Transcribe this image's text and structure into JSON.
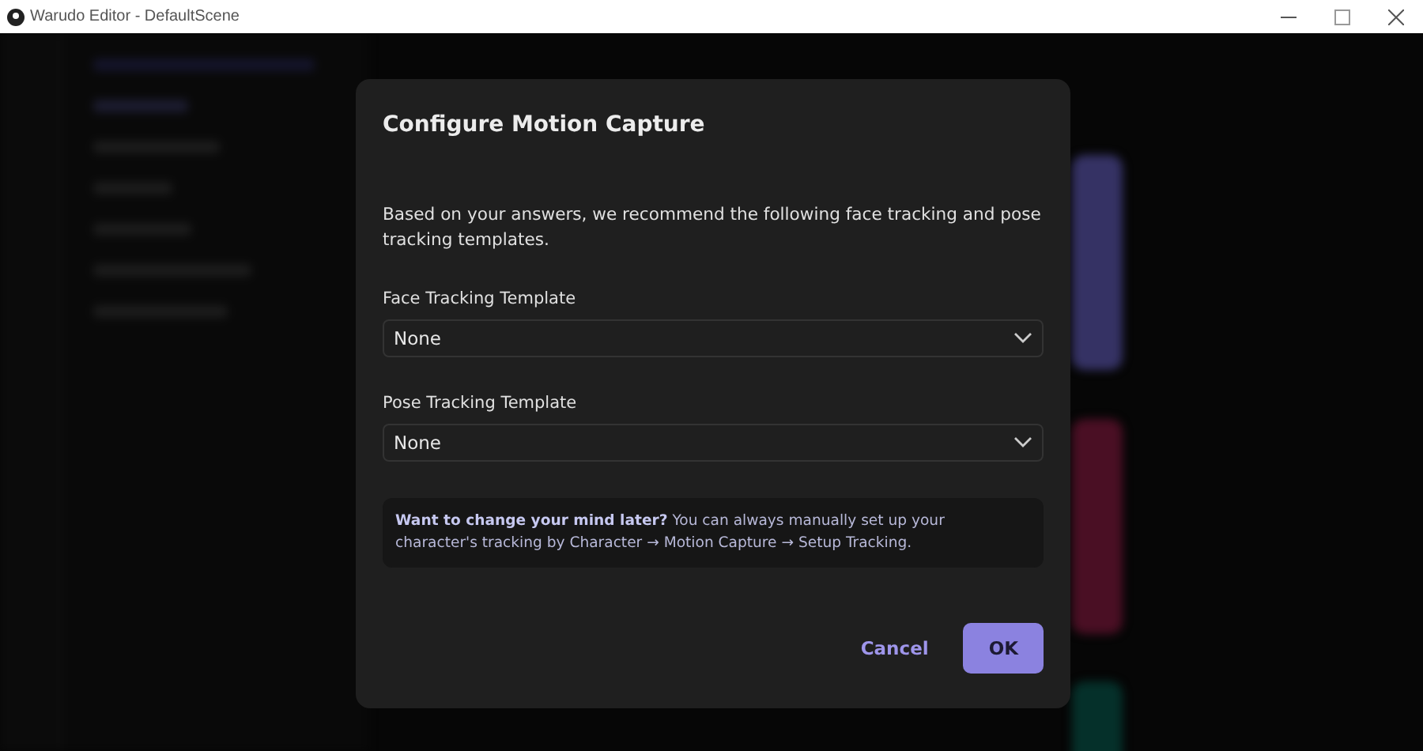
{
  "window": {
    "title": "Warudo Editor - DefaultScene"
  },
  "dialog": {
    "title": "Configure Motion Capture",
    "message": "Based on your answers, we recommend the following face tracking and pose tracking templates.",
    "fields": [
      {
        "label": "Face Tracking Template",
        "value": "None"
      },
      {
        "label": "Pose Tracking Template",
        "value": "None"
      }
    ],
    "note": "**Want to change your mind later?** You can always manually set up your character's tracking by Character → Motion Capture → Setup Tracking.",
    "buttons": [
      {
        "label": "Cancel",
        "kind": "text"
      },
      {
        "label": "OK",
        "kind": "primary"
      }
    ]
  }
}
